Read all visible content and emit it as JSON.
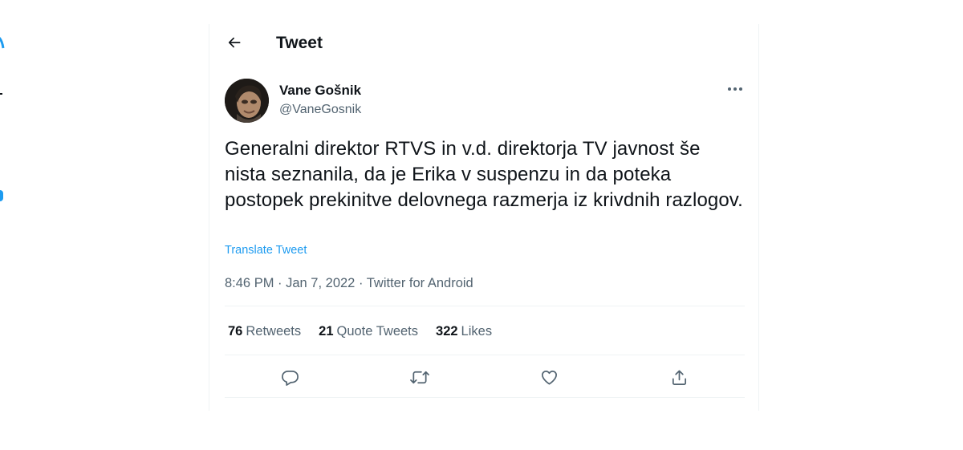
{
  "header": {
    "title": "Tweet",
    "back_icon": "arrow-left-icon"
  },
  "tweet": {
    "author": {
      "display_name": "Vane Gošnik",
      "handle": "@VaneGosnik"
    },
    "text": "Generalni direktor RTVS in v.d. direktorja TV javnost še nista seznanila, da je Erika v suspenzu in da poteka postopek prekinitve delovnega razmerja iz krivdnih razlogov.",
    "translate_label": "Translate Tweet",
    "meta": {
      "time": "8:46 PM",
      "separator": " · ",
      "date": "Jan 7, 2022",
      "source": "Twitter for Android"
    },
    "stats": {
      "retweets_count": "76",
      "retweets_label": "Retweets",
      "quotes_count": "21",
      "quotes_label": "Quote Tweets",
      "likes_count": "322",
      "likes_label": "Likes"
    }
  },
  "actions": {
    "reply_icon": "reply-icon",
    "retweet_icon": "retweet-icon",
    "like_icon": "heart-icon",
    "share_icon": "share-icon"
  },
  "colors": {
    "accent": "#1d9bf0",
    "secondary_text": "#536471",
    "divider": "#eff3f4"
  }
}
